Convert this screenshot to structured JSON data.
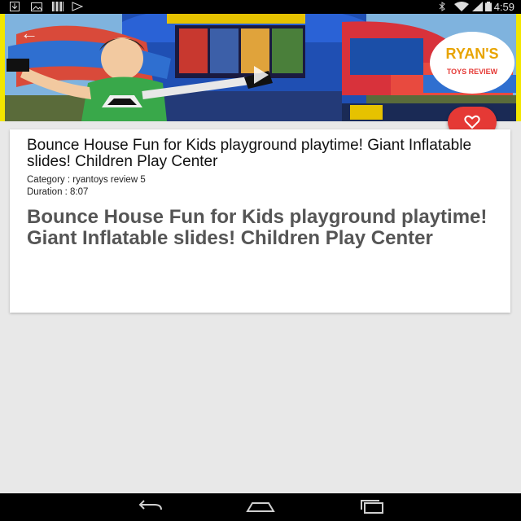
{
  "status_bar": {
    "time": "4:59",
    "left_icons": [
      "download-icon",
      "image-icon",
      "barcode-icon",
      "cast-icon"
    ],
    "right_icons": [
      "bluetooth-icon",
      "wifi-icon",
      "signal-icon",
      "battery-icon"
    ]
  },
  "hero": {
    "logo_line1": "RYAN'S",
    "logo_line2": "TOYS REVIEW",
    "colors": {
      "accent": "#e53935",
      "frame": "#f2e600"
    }
  },
  "video": {
    "title": "Bounce House Fun for Kids playground playtime! Giant Inflatable slides! Children Play Center",
    "category_label": "Category : ryantoys review 5",
    "duration_label": "Duration : 8:07",
    "description": "Bounce House Fun for Kids playground playtime! Giant Inflatable slides! Children Play Center"
  },
  "actions": {
    "favorite_icon": "heart-icon"
  },
  "nav_bar": {
    "buttons": [
      "back-icon",
      "home-icon",
      "recents-icon"
    ]
  }
}
